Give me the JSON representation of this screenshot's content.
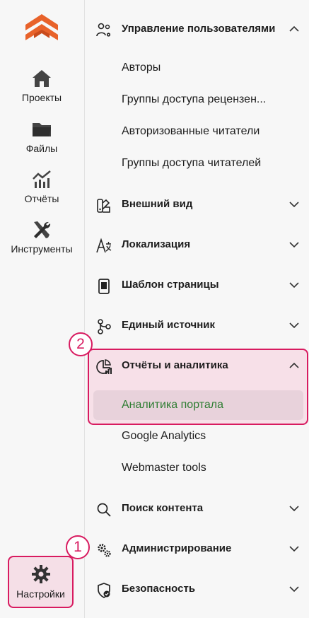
{
  "rail": {
    "items": [
      {
        "label": "Проекты",
        "icon": "home-icon"
      },
      {
        "label": "Файлы",
        "icon": "folder-icon"
      },
      {
        "label": "Отчёты",
        "icon": "chart-icon"
      },
      {
        "label": "Инструменты",
        "icon": "tools-icon"
      }
    ],
    "settings": {
      "label": "Настройки",
      "icon": "gear-icon"
    }
  },
  "panel": {
    "user_management": {
      "label": "Управление пользователями",
      "icon": "users-gear-icon",
      "items": [
        "Авторы",
        "Группы доступа рецензен...",
        "Авторизованные читатели",
        "Группы доступа читателей"
      ]
    },
    "appearance": {
      "label": "Внешний вид",
      "icon": "palette-icon"
    },
    "localization": {
      "label": "Локализация",
      "icon": "translate-icon"
    },
    "page_template": {
      "label": "Шаблон страницы",
      "icon": "page-template-icon"
    },
    "single_source": {
      "label": "Единый источник",
      "icon": "branch-icon"
    },
    "reports_analytics": {
      "label": "Отчёты и аналитика",
      "icon": "pie-chart-icon",
      "items": [
        "Аналитика портала",
        "Google Analytics",
        "Webmaster tools"
      ],
      "active_item": "Аналитика портала"
    },
    "content_search": {
      "label": "Поиск контента",
      "icon": "search-icon"
    },
    "administration": {
      "label": "Администрирование",
      "icon": "gears-icon"
    },
    "security": {
      "label": "Безопасность",
      "icon": "shield-icon"
    }
  },
  "annotations": {
    "step1": "1",
    "step2": "2"
  },
  "colors": {
    "accent": "#d81b60",
    "active_text": "#2e7d32",
    "logo": "#e8622a"
  }
}
